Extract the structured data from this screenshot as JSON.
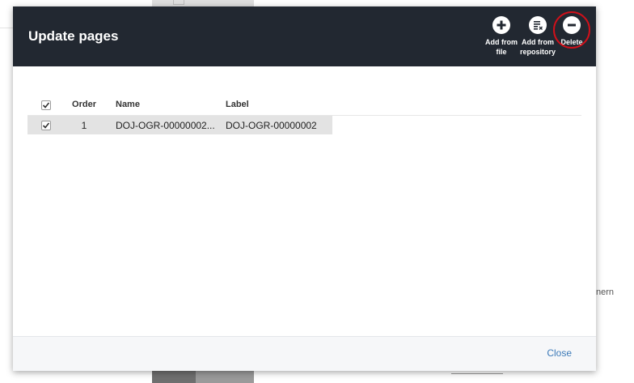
{
  "background": {
    "right_text": "nern"
  },
  "modal": {
    "title": "Update pages",
    "actions": [
      {
        "line1": "Add from",
        "line2": "file",
        "icon": "plus-circle-icon"
      },
      {
        "line1": "Add from",
        "line2": "repository",
        "icon": "repository-list-icon"
      },
      {
        "line1": "Delete",
        "line2": "",
        "icon": "minus-circle-icon"
      }
    ],
    "table": {
      "headers": {
        "order": "Order",
        "name": "Name",
        "label": "Label"
      },
      "rows": [
        {
          "checked": true,
          "order": "1",
          "name": "DOJ-OGR-00000002...",
          "label": "DOJ-OGR-00000002"
        }
      ]
    },
    "footer": {
      "close_label": "Close"
    }
  },
  "colors": {
    "header_bg": "#222831",
    "highlight_ring": "#d0101a",
    "link": "#3c7ab8",
    "selected_row": "#e3e3e3"
  }
}
